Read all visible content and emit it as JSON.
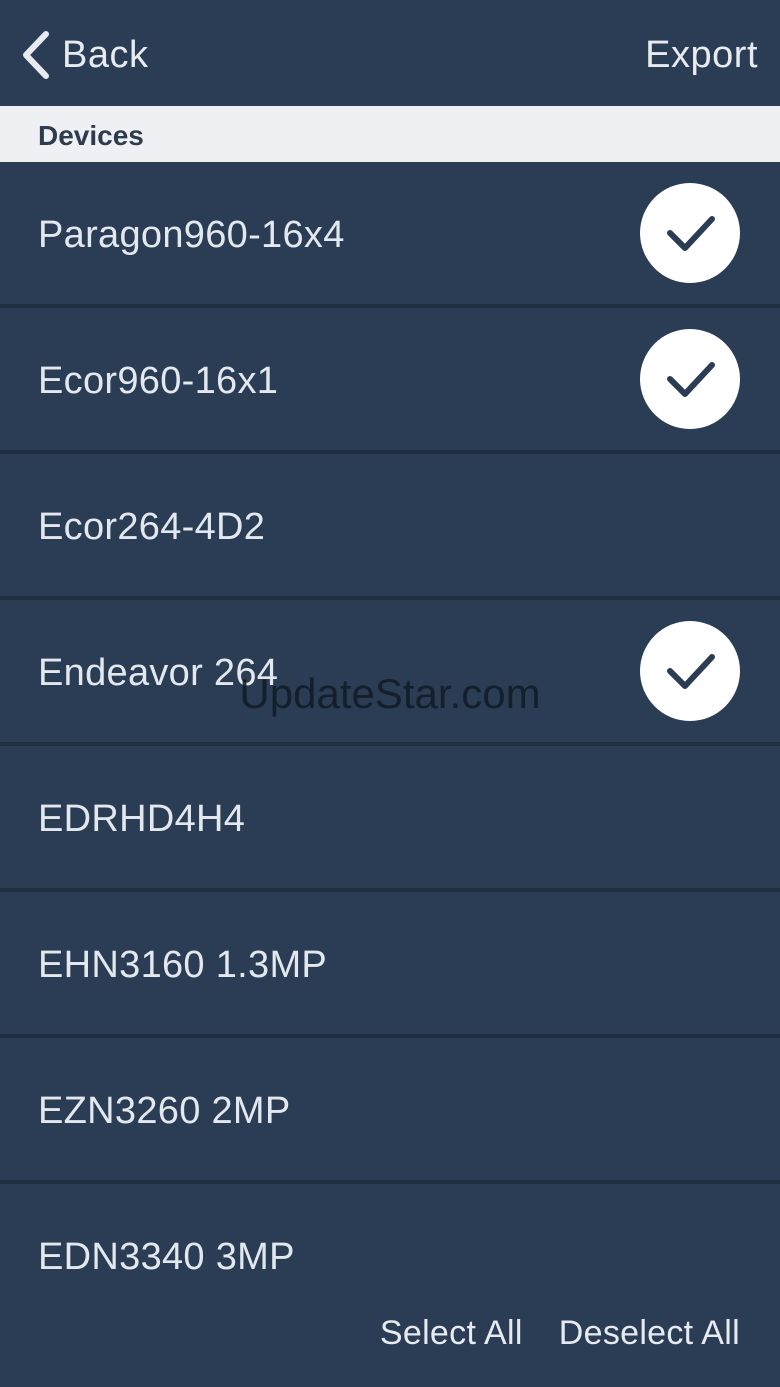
{
  "navbar": {
    "back_label": "Back",
    "back_icon": "chevron-left-icon",
    "export_label": "Export"
  },
  "section": {
    "title": "Devices"
  },
  "devices": [
    {
      "label": "Paragon960-16x4",
      "selected": true
    },
    {
      "label": "Ecor960-16x1",
      "selected": true
    },
    {
      "label": "Ecor264-4D2",
      "selected": false
    },
    {
      "label": "Endeavor 264",
      "selected": true
    },
    {
      "label": "EDRHD4H4",
      "selected": false
    },
    {
      "label": "EHN3160 1.3MP",
      "selected": false
    },
    {
      "label": "EZN3260 2MP",
      "selected": false
    },
    {
      "label": "EDN3340 3MP",
      "selected": false
    }
  ],
  "footer": {
    "select_all_label": "Select All",
    "deselect_all_label": "Deselect All"
  },
  "watermark": {
    "text": "UpdateStar.com"
  },
  "colors": {
    "background": "#2a3d54",
    "header_band": "#eef0f3",
    "divider": "#1f2f42",
    "check_fill": "#ffffff",
    "check_mark": "#2a3d54"
  }
}
